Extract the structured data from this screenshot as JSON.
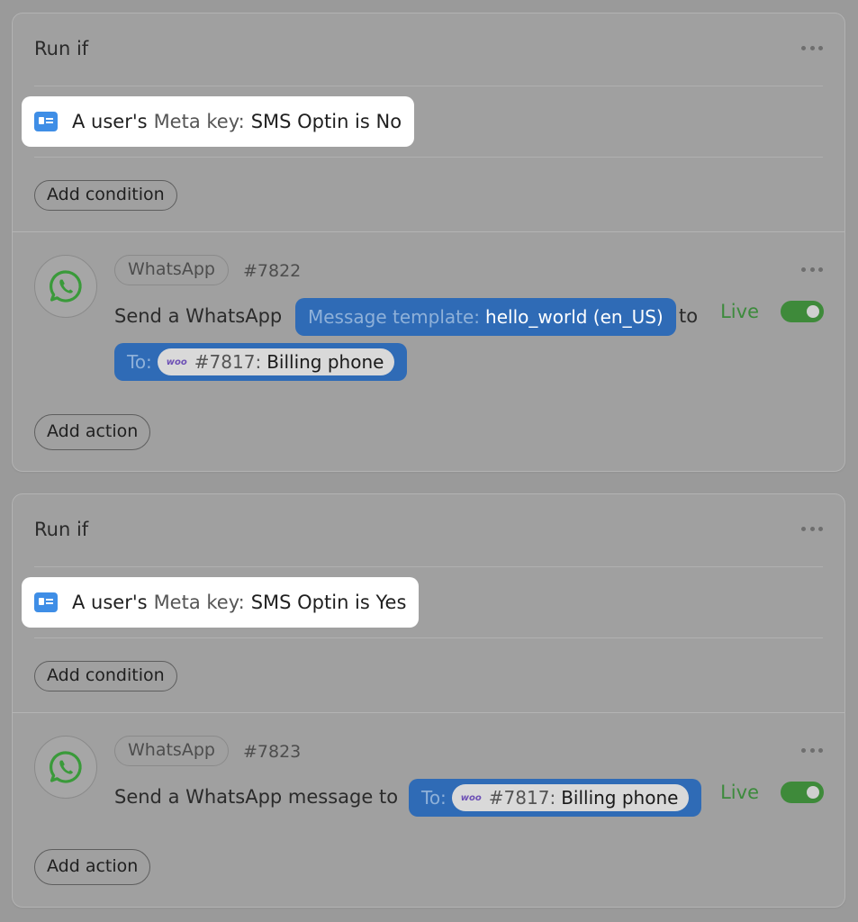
{
  "blocks": [
    {
      "run_if_label": "Run if",
      "condition": {
        "prefix": "A user's",
        "key_label": "Meta key:",
        "expression": "SMS Optin is No"
      },
      "add_condition_label": "Add condition",
      "action": {
        "tag": "WhatsApp",
        "ref": "#7822",
        "text_before": "Send a WhatsApp",
        "template_token": {
          "label": "Message template:",
          "value": "hello_world (en_US)"
        },
        "text_after": "to",
        "to_token": {
          "label": "To:",
          "woo": "woo",
          "ref": "#7817:",
          "value": "Billing phone"
        },
        "status": "Live"
      },
      "add_action_label": "Add action"
    },
    {
      "run_if_label": "Run if",
      "condition": {
        "prefix": "A user's",
        "key_label": "Meta key:",
        "expression": "SMS Optin is Yes"
      },
      "add_condition_label": "Add condition",
      "action": {
        "tag": "WhatsApp",
        "ref": "#7823",
        "text_before": "Send a WhatsApp message to",
        "to_token": {
          "label": "To:",
          "woo": "woo",
          "ref": "#7817:",
          "value": "Billing phone"
        },
        "status": "Live"
      },
      "add_action_label": "Add action"
    }
  ],
  "colors": {
    "live_green": "#3c8a3c",
    "token_blue": "#2f6bb6",
    "whatsapp_green": "#3a9a3a"
  }
}
